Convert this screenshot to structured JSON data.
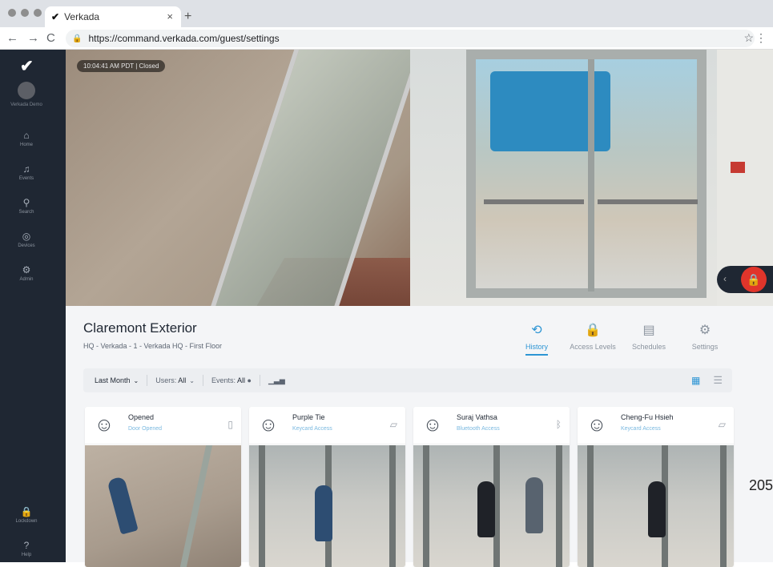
{
  "browser": {
    "tab_title": "Verkada",
    "tab_logo": "✔",
    "new_tab": "+",
    "url": "https://command.verkada.com/guest/settings"
  },
  "sidebar": {
    "org_label": "Verkada Demo",
    "items": [
      {
        "label": "Home",
        "icon": "home-icon",
        "glyph": "⌂"
      },
      {
        "label": "Events",
        "icon": "bell-icon",
        "glyph": "♫"
      },
      {
        "label": "Search",
        "icon": "search-icon",
        "glyph": "⚲"
      },
      {
        "label": "Devices",
        "icon": "devices-icon",
        "glyph": "◎"
      },
      {
        "label": "Admin",
        "icon": "admin-icon",
        "glyph": "⚙"
      },
      {
        "label": "Lockdown",
        "icon": "lock-icon",
        "glyph": "🔒"
      },
      {
        "label": "Help",
        "icon": "help-icon",
        "glyph": "?"
      }
    ]
  },
  "video": {
    "timestamp": "10:04:41 AM PDT | Closed"
  },
  "door": {
    "title": "Claremont Exterior",
    "subtitle": "HQ - Verkada - 1 - Verkada HQ - First Floor"
  },
  "tabs": [
    {
      "label": "History",
      "icon": "history-icon",
      "glyph": "⟲",
      "active": true
    },
    {
      "label": "Access Levels",
      "icon": "lock-icon",
      "glyph": "🔒",
      "active": false
    },
    {
      "label": "Schedules",
      "icon": "schedule-icon",
      "glyph": "▤",
      "active": false
    },
    {
      "label": "Settings",
      "icon": "gear-icon",
      "glyph": "⚙",
      "active": false
    }
  ],
  "filters": {
    "range": "Last Month",
    "users_label": "Users:",
    "users_value": "All",
    "events_label": "Events:",
    "events_value": "All"
  },
  "cards": [
    {
      "title": "Opened",
      "subtitle": "Door Opened",
      "icon": "door-icon",
      "glyph": "▯"
    },
    {
      "title": "Purple Tie",
      "subtitle": "Keycard Access",
      "icon": "keycard-icon",
      "glyph": "▱"
    },
    {
      "title": "Suraj Vathsa",
      "subtitle": "Bluetooth Access",
      "icon": "bluetooth-icon",
      "glyph": "ᛒ"
    },
    {
      "title": "Cheng-Fu Hsieh",
      "subtitle": "Keycard Access",
      "icon": "keycard-icon",
      "glyph": "▱"
    }
  ],
  "page_number": "205",
  "colors": {
    "accent": "#2d95d4",
    "sidebar": "#1f2733",
    "lock_red": "#e0352b"
  }
}
